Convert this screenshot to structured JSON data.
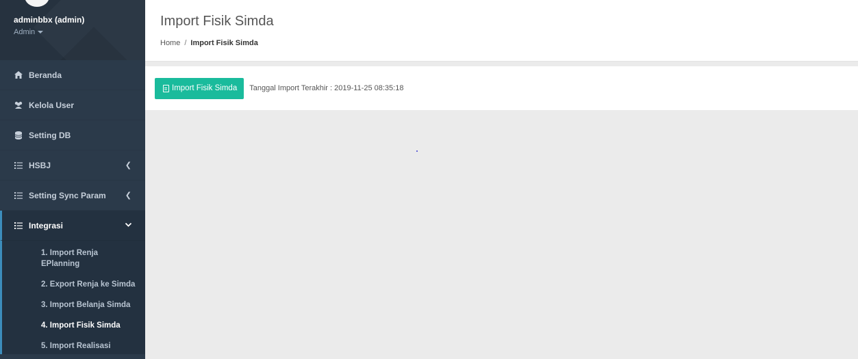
{
  "sidebar": {
    "user_name": "adminbbx (admin)",
    "user_role": "Admin",
    "items": [
      {
        "label": "Beranda",
        "icon": "home-icon"
      },
      {
        "label": "Kelola User",
        "icon": "users-icon"
      },
      {
        "label": "Setting DB",
        "icon": "database-icon"
      },
      {
        "label": "HSBJ",
        "icon": "list-icon"
      },
      {
        "label": "Setting Sync Param",
        "icon": "list-icon"
      },
      {
        "label": "Integrasi",
        "icon": "list-icon"
      }
    ],
    "submenu": [
      "1. Import Renja EPlanning",
      "2. Export Renja ke Simda",
      "3. Import Belanja Simda",
      "4. Import Fisik Simda",
      "5. Import Realisasi"
    ]
  },
  "header": {
    "title": "Import Fisik Simda",
    "breadcrumb_home": "Home",
    "breadcrumb_sep": "/",
    "breadcrumb_current": "Import Fisik Simda"
  },
  "toolbar": {
    "import_button_label": "Import Fisik Simda",
    "last_import_text": "Tanggal Import Terakhir : 2019-11-25 08:35:18"
  },
  "colors": {
    "sidebar_bg": "#2b3a4a",
    "accent_blue": "#3c8dbc",
    "button_green": "#1abb9c"
  }
}
